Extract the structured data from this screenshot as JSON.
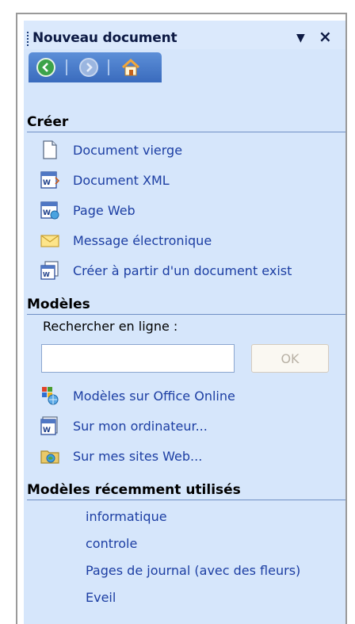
{
  "panel": {
    "title": "Nouveau document",
    "dropdown_glyph": "▼",
    "close_glyph": "×"
  },
  "nav": {
    "back_icon": "back-arrow-icon",
    "forward_icon": "forward-arrow-icon",
    "home_icon": "home-icon"
  },
  "creer": {
    "heading": "Créer",
    "items": [
      {
        "label": "Document vierge",
        "icon": "blank-document-icon"
      },
      {
        "label": "Document XML",
        "icon": "xml-document-icon"
      },
      {
        "label": "Page Web",
        "icon": "web-page-icon"
      },
      {
        "label": "Message électronique",
        "icon": "envelope-icon"
      },
      {
        "label": "Créer à partir d'un document exist",
        "icon": "document-from-existing-icon"
      }
    ]
  },
  "modeles": {
    "heading": "Modèles",
    "search_label": "Rechercher en ligne :",
    "search_value": "",
    "ok_label": "OK",
    "items": [
      {
        "label": "Modèles sur Office Online",
        "icon": "office-online-icon"
      },
      {
        "label": "Sur mon ordinateur...",
        "icon": "computer-templates-icon"
      },
      {
        "label": "Sur mes sites Web...",
        "icon": "web-folder-icon"
      }
    ]
  },
  "recents": {
    "heading": "Modèles récemment utilisés",
    "items": [
      "informatique",
      "controle",
      "Pages de journal (avec des fleurs)",
      "Eveil"
    ]
  }
}
